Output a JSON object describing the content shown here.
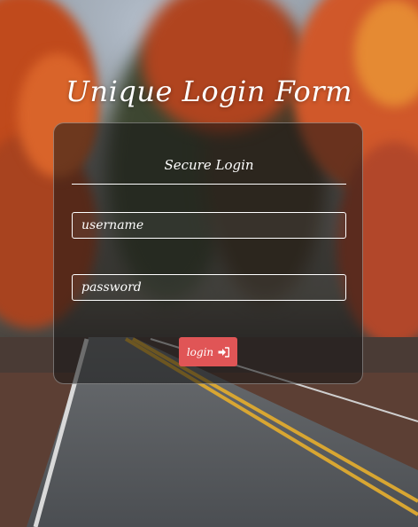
{
  "page": {
    "title": "Unique Login Form"
  },
  "form": {
    "heading": "Secure Login",
    "username_placeholder": "username",
    "password_placeholder": "password",
    "login_label": "login",
    "login_icon": "sign-in-icon"
  },
  "colors": {
    "button": "#e05556",
    "card_overlay": "rgba(20,20,20,0.55)",
    "text": "#ffffff"
  }
}
